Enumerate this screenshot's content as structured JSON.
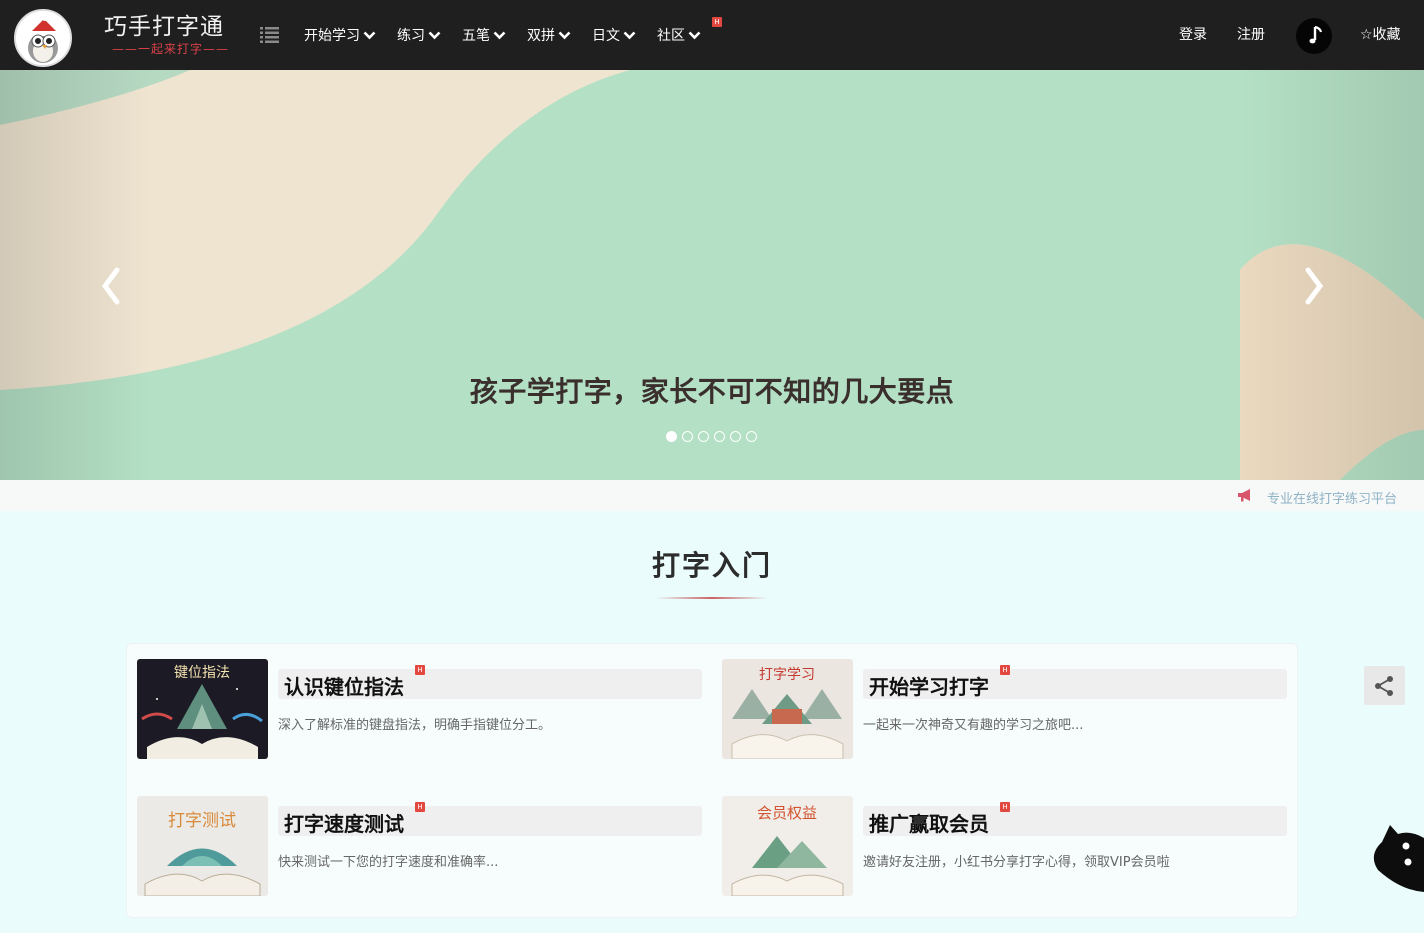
{
  "header": {
    "brand_main": "巧手打字通",
    "brand_sub": "——一起来打字——",
    "nav": [
      {
        "label": "开始学习"
      },
      {
        "label": "练习"
      },
      {
        "label": "五笔"
      },
      {
        "label": "双拼"
      },
      {
        "label": "日文"
      },
      {
        "label": "社区"
      }
    ],
    "hot_badge": "H",
    "login": "登录",
    "register": "注册",
    "favorite": "☆收藏"
  },
  "banner": {
    "title": "孩子学打字，家长不可不知的几大要点",
    "slide_count": 6,
    "active_slide": 1
  },
  "notice": {
    "text": "专业在线打字练习平台"
  },
  "section": {
    "title": "打字入门"
  },
  "cards": [
    {
      "title": "认识键位指法",
      "desc": "深入了解标准的键盘指法，明确手指键位分工。",
      "thumb_text": "键位指法",
      "badge": "H"
    },
    {
      "title": "开始学习打字",
      "desc": "一起来一次神奇又有趣的学习之旅吧...",
      "thumb_text": "打字学习",
      "badge": "H"
    },
    {
      "title": "打字速度测试",
      "desc": "快来测试一下您的打字速度和准确率...",
      "thumb_text": "打字测试",
      "badge": "H"
    },
    {
      "title": "推广赢取会员",
      "desc": "邀请好友注册，小红书分享打字心得，领取VIP会员啦",
      "thumb_text": "会员权益",
      "badge": "H"
    }
  ],
  "colors": {
    "header_bg": "#1f1f1f",
    "banner_green": "#b4e0c5",
    "banner_cream": "#efe4d0",
    "hot_red": "#e34840",
    "page_bg": "#eafcfb"
  }
}
